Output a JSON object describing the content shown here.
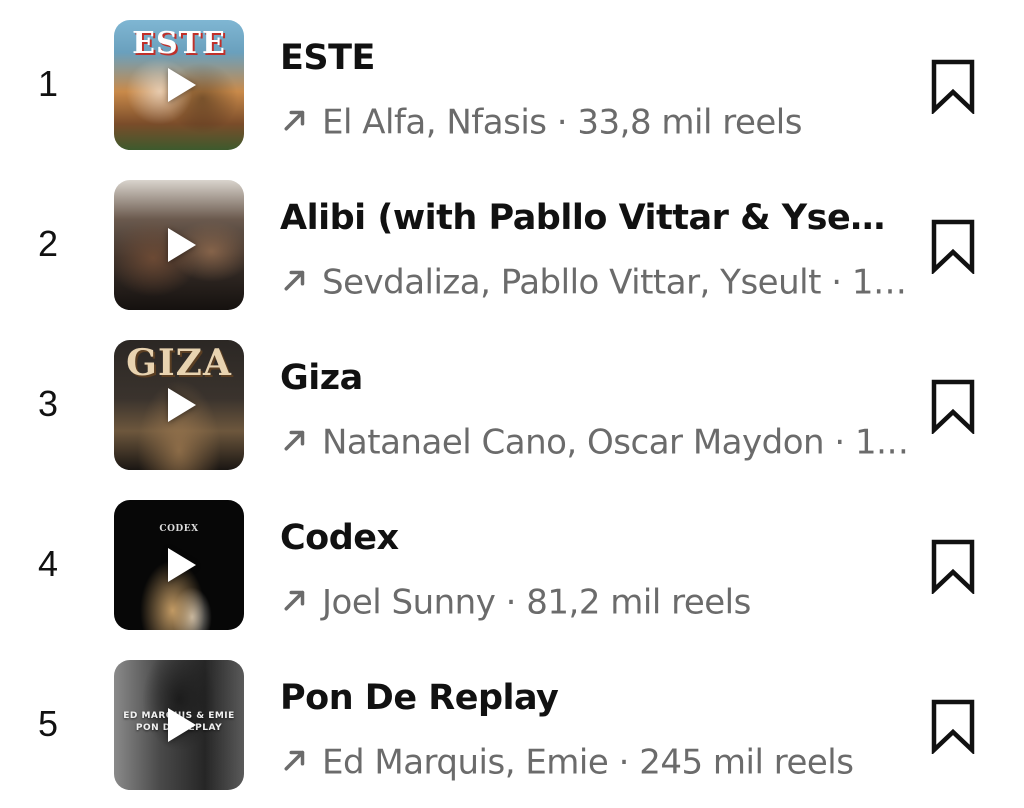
{
  "tracks": [
    {
      "rank": "1",
      "title": "ESTE",
      "meta": "El Alfa, Nfasis · 33,8 mil reels",
      "cover_text": "ESTE",
      "cover_colors": [
        "#6fa8c9",
        "#c9783d",
        "#2f5a2a"
      ]
    },
    {
      "rank": "2",
      "title": "Alibi (with Pabllo Vittar & Yseult)",
      "meta": "Sevdaliza, Pabllo Vittar, Yseult · 1…",
      "cover_text": "",
      "cover_colors": [
        "#3b3430",
        "#8a6a4f",
        "#1a1715"
      ]
    },
    {
      "rank": "3",
      "title": "Giza",
      "meta": "Natanael Cano, Oscar Maydon · 1.…",
      "cover_text": "GIZA",
      "cover_colors": [
        "#2a2622",
        "#9b7a52",
        "#100e0c"
      ]
    },
    {
      "rank": "4",
      "title": "Codex",
      "meta": "Joel Sunny · 81,2 mil reels",
      "cover_text": "CODEX",
      "cover_colors": [
        "#050505",
        "#caa46e",
        "#141414"
      ]
    },
    {
      "rank": "5",
      "title": "Pon De Replay",
      "meta": "Ed Marquis, Emie · 245 mil reels",
      "cover_text": "ED MARQUIS & EMIE PON DE REPLAY",
      "cover_colors": [
        "#6f6f6f",
        "#2c2c2c",
        "#9a9a9a"
      ]
    }
  ],
  "icons": {
    "play": "play-icon",
    "trend": "trending-up-arrow-icon",
    "bookmark": "bookmark-icon"
  },
  "colors": {
    "text_primary": "#111111",
    "text_secondary": "#6b6b6b",
    "background": "#ffffff"
  }
}
